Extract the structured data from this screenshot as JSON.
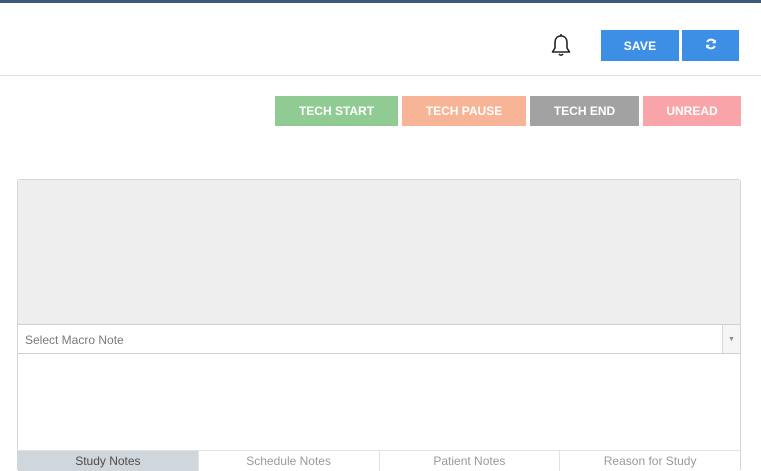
{
  "header": {
    "bell_icon": "bell-icon",
    "save_label": "SAVE",
    "refresh_icon": "refresh-icon",
    "accent": "#3d8fe6"
  },
  "tech_actions": {
    "start_label": "TECH START",
    "pause_label": "TECH PAUSE",
    "end_label": "TECH END",
    "unread_label": "UNREAD",
    "colors": {
      "start": "#8fcb93",
      "pause": "#f8b496",
      "end": "#a2a2a2",
      "unread": "#f8a4a8"
    }
  },
  "notes": {
    "macro_placeholder": "Select Macro Note",
    "textarea_value": "",
    "tabs": [
      {
        "label": "Study Notes",
        "active": true
      },
      {
        "label": "Schedule Notes",
        "active": false
      },
      {
        "label": "Patient Notes",
        "active": false
      },
      {
        "label": "Reason for Study",
        "active": false
      }
    ]
  }
}
